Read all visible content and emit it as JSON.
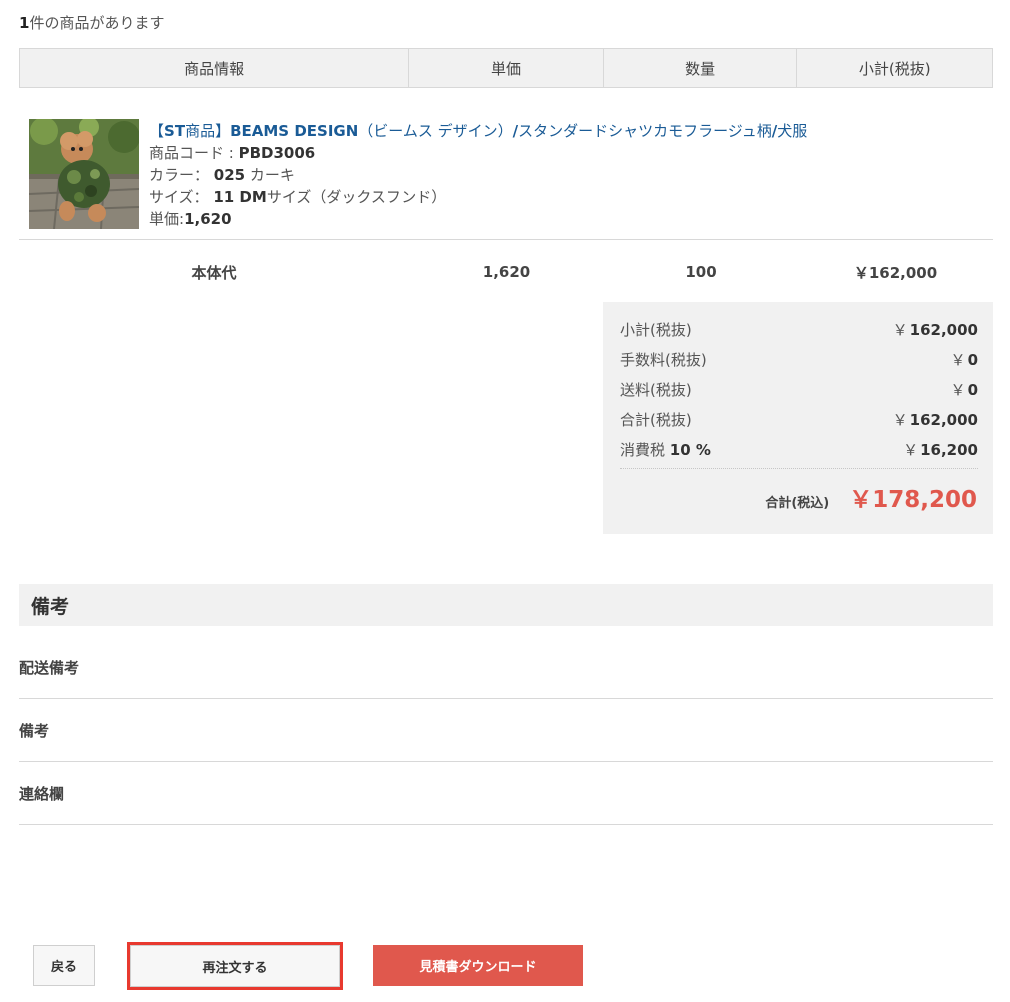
{
  "item_count": {
    "number": "1",
    "suffix": "件の商品があります"
  },
  "table_headers": [
    "商品情報",
    "単価",
    "数量",
    "小計(税抜)"
  ],
  "product": {
    "name_bracket_open": "【",
    "name_st": "ST",
    "name_part2": "商品】",
    "name_brand": "BEAMS DESIGN",
    "name_part3": "（ビームス デザイン）",
    "name_slash1": "/",
    "name_part4": "スタンダードシャツカモフラージュ柄",
    "name_slash2": "/",
    "name_part5": "犬服",
    "code_label": "商品コード : ",
    "code_value": "PBD3006",
    "color_label": "カラー： ",
    "color_value": "025",
    "color_name": " カーキ",
    "size_label": "サイズ： ",
    "size_value": "11 DM",
    "size_name": "サイズ（ダックスフンド）",
    "price_label": "単価:",
    "price_value": "1,620",
    "image": "dog-in-camouflage-shirt"
  },
  "line": {
    "label": "本体代",
    "unit_price": "1,620",
    "quantity": "100",
    "subtotal": "￥162,000"
  },
  "summary": {
    "rows": [
      {
        "label": "小計(税抜)",
        "yen": "￥",
        "amount": "162,000"
      },
      {
        "label": "手数料(税抜)",
        "yen": "￥",
        "amount": "0"
      },
      {
        "label": "送料(税抜)",
        "yen": "￥",
        "amount": "0"
      },
      {
        "label": "合計(税抜)",
        "yen": "￥",
        "amount": "162,000"
      }
    ],
    "tax_label": "消費税",
    "tax_rate": "10 %",
    "tax_yen": "￥",
    "tax_amount": "16,200",
    "total_label": "合計(税込)",
    "total_amount": "￥178,200"
  },
  "remarks": {
    "title": "備考",
    "rows": [
      "配送備考",
      "備考",
      "連絡欄"
    ]
  },
  "buttons": {
    "back": "戻る",
    "reorder": "再注文する",
    "quote_download": "見積書ダウンロード"
  },
  "colors": {
    "accent_red": "#e0584d",
    "link_blue": "#1a5b96",
    "highlight_outline": "#e8392f",
    "panel_gray": "#f1f1f1"
  }
}
